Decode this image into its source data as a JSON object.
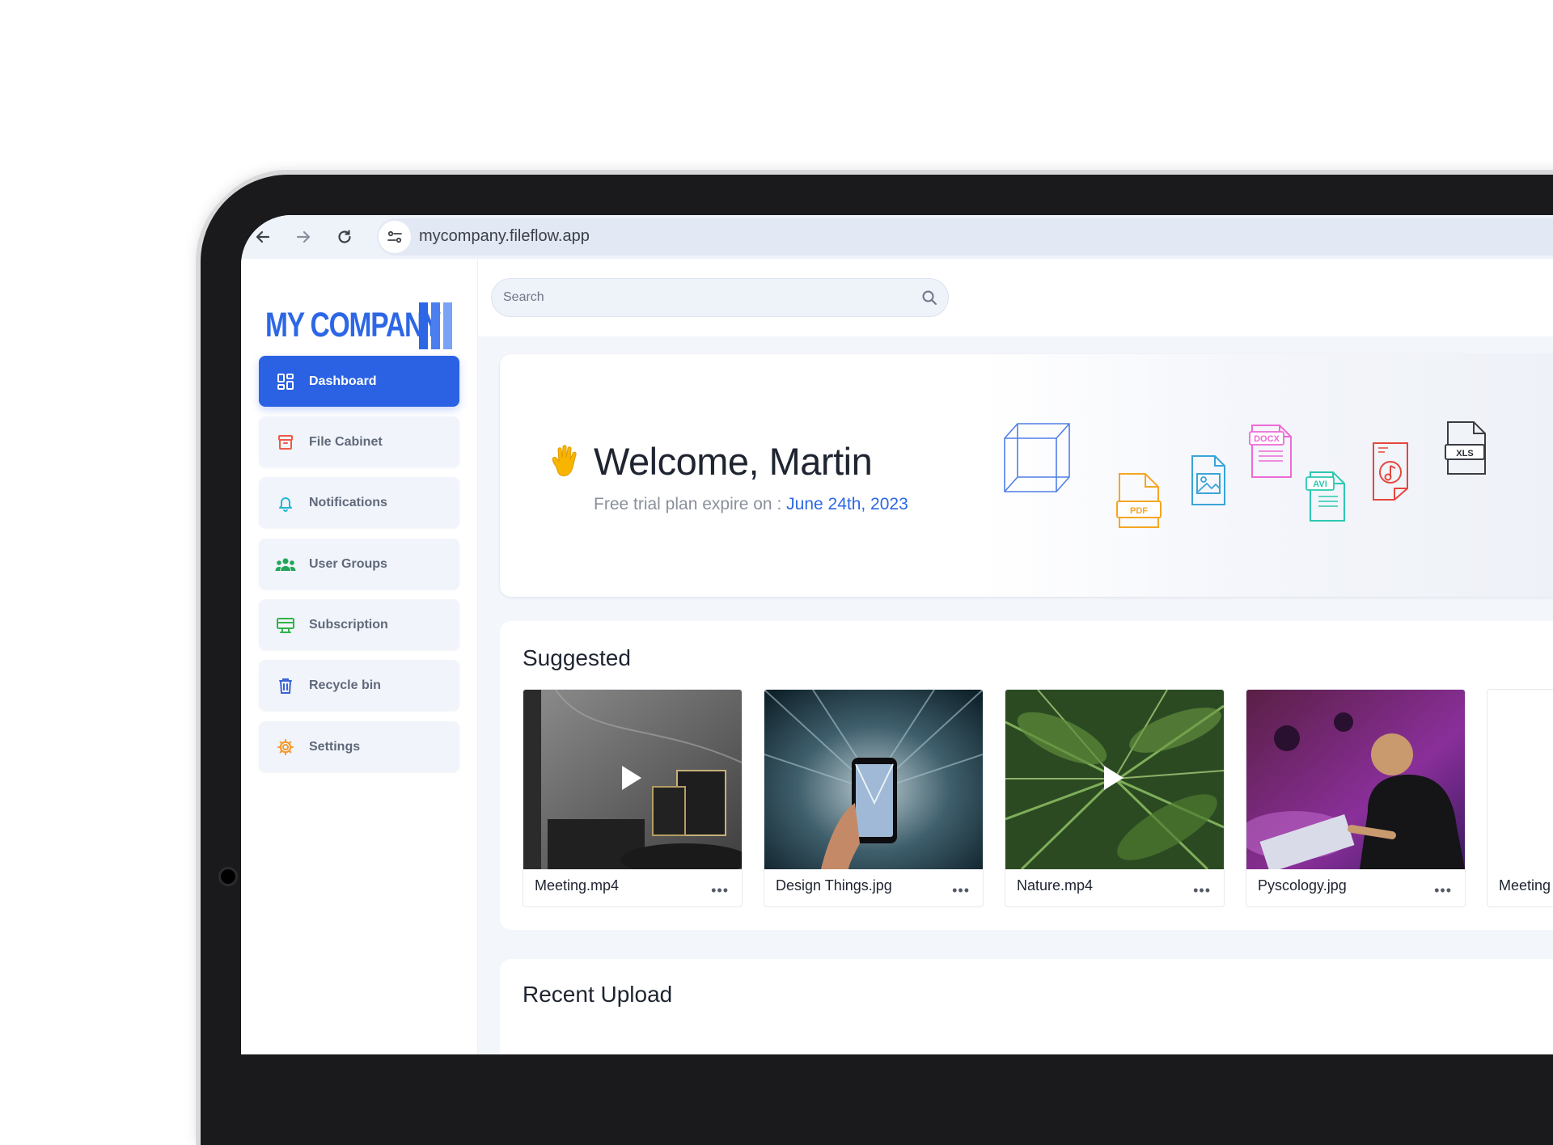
{
  "browser": {
    "url": "mycompany.fileflow.app",
    "icons": [
      "back-arrow-icon",
      "forward-arrow-icon",
      "reload-icon",
      "site-settings-icon"
    ]
  },
  "brand": {
    "name": "MY COMPANY",
    "color": "#2d67e6",
    "accent_light": "#7aa2f5"
  },
  "sidebar": {
    "items": [
      {
        "label": "Dashboard",
        "icon": "dashboard-grid-icon",
        "color": "#ffffff",
        "active": true
      },
      {
        "label": "File Cabinet",
        "icon": "file-cabinet-icon",
        "color": "#f05a4a",
        "active": false
      },
      {
        "label": "Notifications",
        "icon": "bell-icon",
        "color": "#22b8d6",
        "active": false
      },
      {
        "label": "User Groups",
        "icon": "users-icon",
        "color": "#21a65a",
        "active": false
      },
      {
        "label": "Subscription",
        "icon": "subscription-icon",
        "color": "#32b24a",
        "active": false
      },
      {
        "label": "Recycle bin",
        "icon": "trash-icon",
        "color": "#3a64d8",
        "active": false
      },
      {
        "label": "Settings",
        "icon": "gear-icon",
        "color": "#f39a2e",
        "active": false
      }
    ]
  },
  "search": {
    "placeholder": "Search"
  },
  "welcome": {
    "title": "Welcome, Martin",
    "subtitle": "Free trial plan expire on :",
    "date": "June 24th, 2023",
    "file_types": [
      "PDF",
      "DOCX",
      "AVI",
      "XLS"
    ]
  },
  "suggested": {
    "title": "Suggested",
    "items": [
      {
        "name": "Meeting.mp4",
        "is_video": true
      },
      {
        "name": "Design Things.jpg",
        "is_video": false
      },
      {
        "name": "Nature.mp4",
        "is_video": true
      },
      {
        "name": "Pyscology.jpg",
        "is_video": false
      },
      {
        "name": "Meeting",
        "is_video": false
      }
    ],
    "menu_glyph": "•••"
  },
  "recent": {
    "title": "Recent Upload"
  }
}
